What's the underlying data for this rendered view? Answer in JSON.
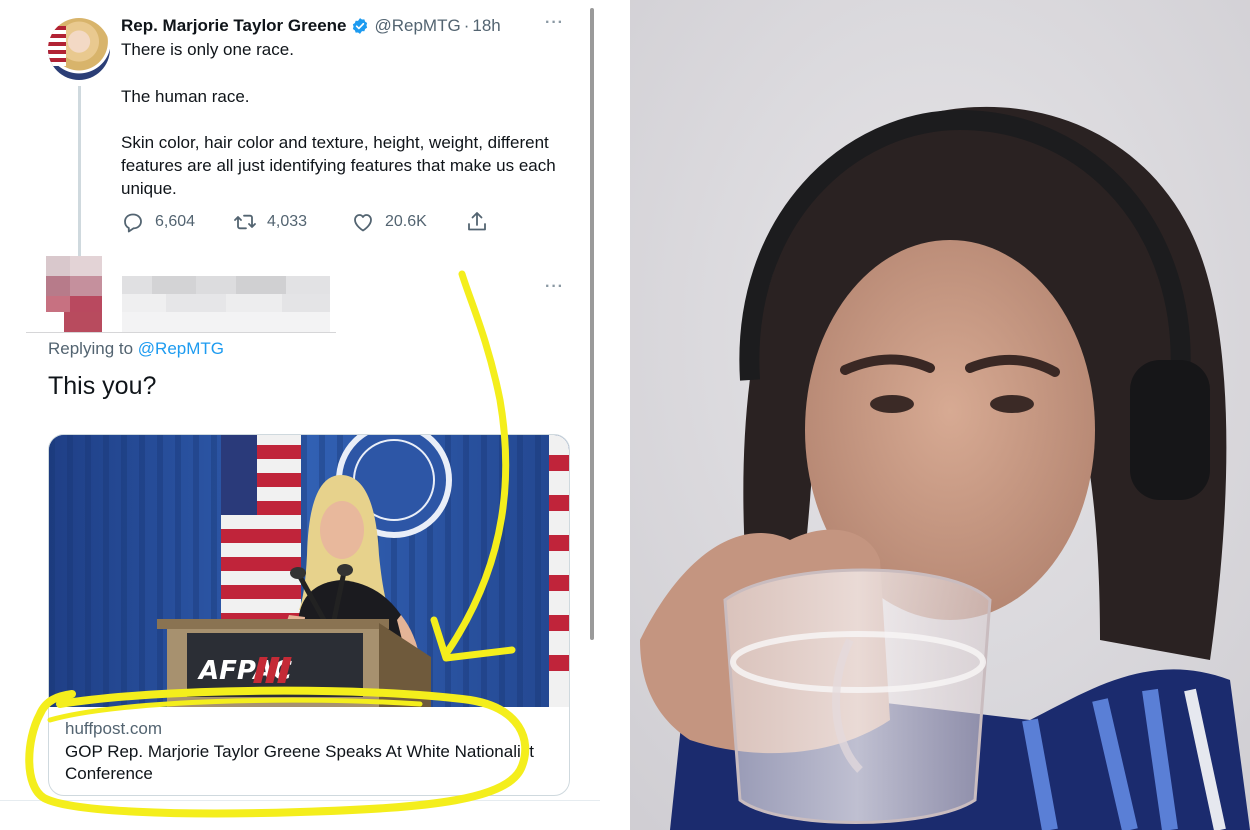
{
  "tweet": {
    "author_name": "Rep. Marjorie Taylor Greene",
    "handle": "@RepMTG",
    "separator": "·",
    "time": "18h",
    "more_glyph": "···",
    "text_line1": "There is only one race.",
    "text_line2": "The human race.",
    "text_line3": "Skin color, hair color and texture, height, weight, different features are all just identifying features that make us each unique.",
    "replies": "6,604",
    "retweets": "4,033",
    "likes": "20.6K",
    "icons": [
      "reply-icon",
      "retweet-icon",
      "like-icon",
      "share-icon",
      "verified-badge-icon"
    ]
  },
  "reply": {
    "more_glyph": "···",
    "replying_prefix": "Replying to",
    "replying_handle": "@RepMTG",
    "text": "This you?",
    "card": {
      "domain": "huffpost.com",
      "title": "GOP Rep. Marjorie Taylor Greene Speaks At White Nationalist Conference",
      "podium_sign": "AFPAC"
    }
  },
  "colors": {
    "link_blue": "#1d9bf0",
    "muted_gray": "#536471",
    "annotation_yellow": "#f4ee1c",
    "verified_blue": "#1d9bf0"
  }
}
